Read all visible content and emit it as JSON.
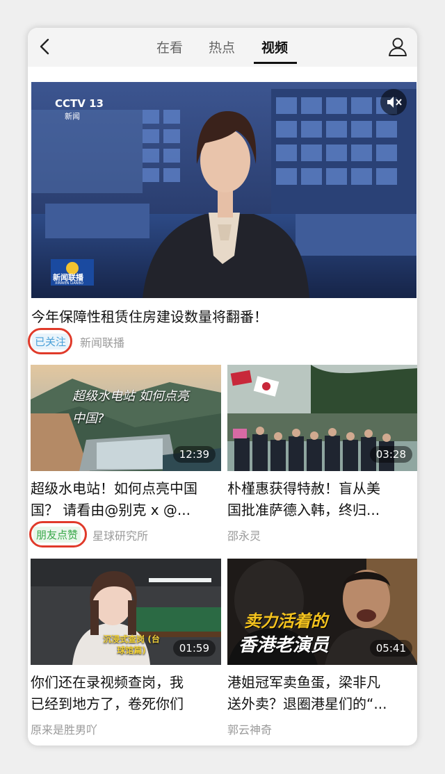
{
  "header": {
    "tabs": [
      {
        "label": "在看",
        "active": false
      },
      {
        "label": "热点",
        "active": false
      },
      {
        "label": "视频",
        "active": true
      }
    ]
  },
  "featured": {
    "channel_logo": "CCTV 13",
    "channel_sub": "新闻",
    "program_logo": "新闻联播",
    "program_logo_en": "XINWEN LIANBO",
    "title": "今年保障性租赁住房建设数量将翻番！",
    "badge": "已关注",
    "source": "新闻联播"
  },
  "videos": [
    {
      "overlay_text": "超级水电站 如何点亮中国?",
      "duration": "12:39",
      "title_line1": "超级水电站！如何点亮中国",
      "title_line2": "国？ 请看由@别克 x @...",
      "badge": "朋友点赞",
      "source": "星球研究所"
    },
    {
      "duration": "03:28",
      "title_line1": "朴槿惠获得特赦！盲从美",
      "title_line2": "国批准萨德入韩，终归...",
      "source": "邵永灵"
    },
    {
      "overlay_text": "沉浸式查岗 (台球馆篇)",
      "duration": "01:59",
      "title_line1": "你们还在录视频查岗，我",
      "title_line2": "已经到地方了，卷死你们",
      "source": "原来是胜男吖"
    },
    {
      "overlay_text_1": "卖力活着的",
      "overlay_text_2": "香港老演员",
      "duration": "05:41",
      "title_line1": "港姐冠军卖鱼蛋，梁非凡",
      "title_line2": "送外卖？退圈港星们的“...",
      "source": "郭云神奇"
    }
  ],
  "colors": {
    "highlight_circle": "#e03a2a",
    "followed_badge": "#4aa0d8",
    "friends_like_badge": "#3aa84a"
  },
  "icons": [
    "back-arrow-icon",
    "user-icon",
    "mute-icon"
  ]
}
